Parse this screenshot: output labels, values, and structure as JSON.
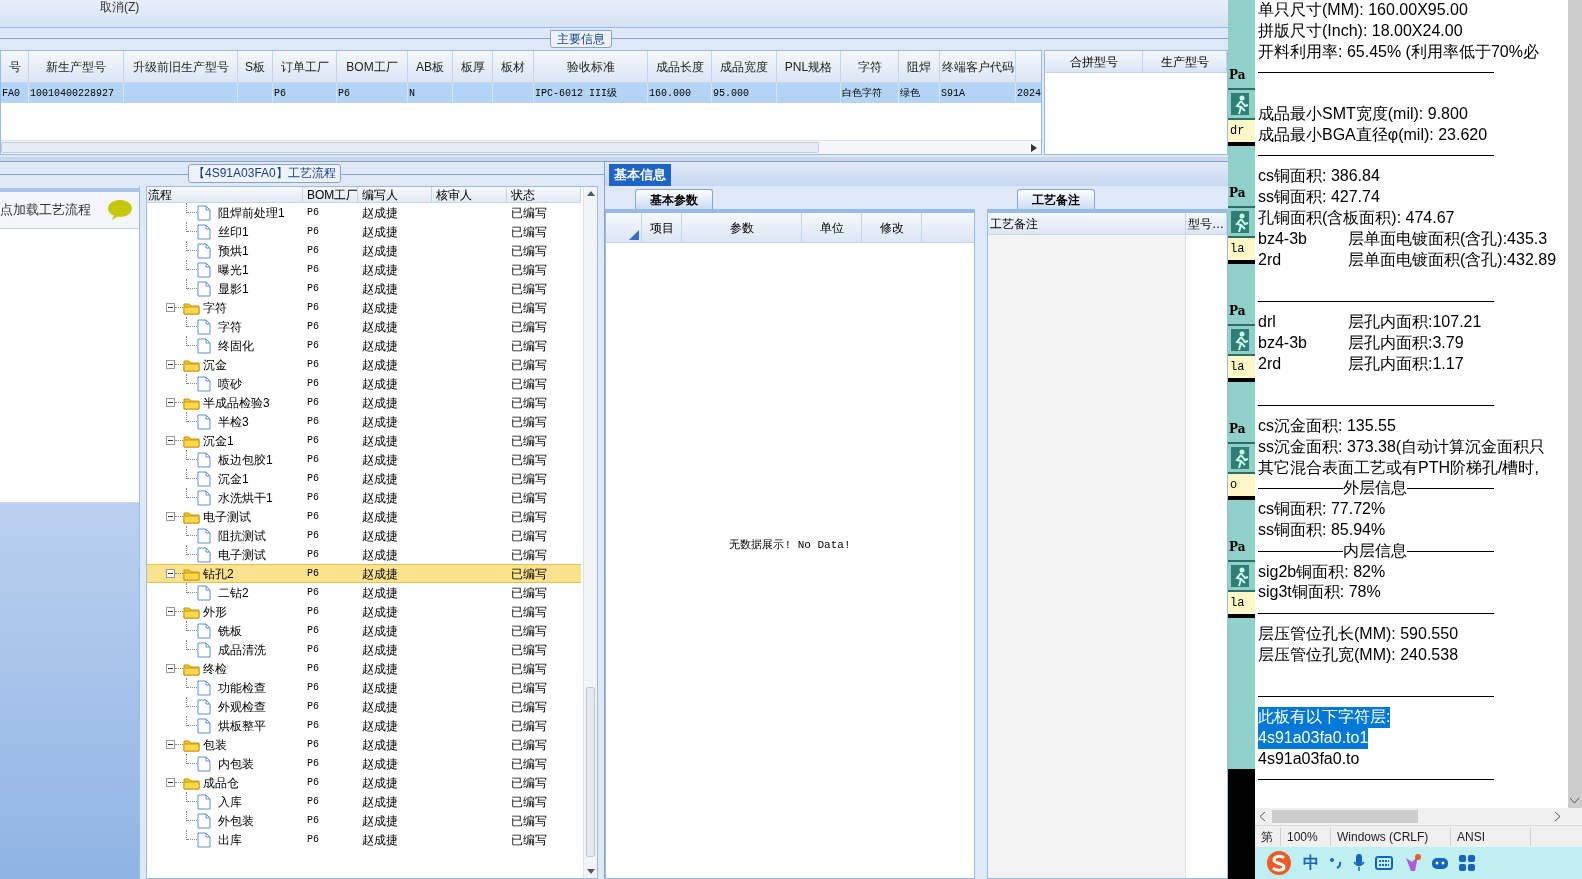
{
  "toolbar": {
    "cancel_label": "取消(Z)"
  },
  "main_section": {
    "title": "主要信息"
  },
  "main_table": {
    "row_selected": true,
    "columns": [
      {
        "header": "号",
        "value": "FA0"
      },
      {
        "header": "新生产型号",
        "value": "10010400228927"
      },
      {
        "header": "升级前旧生产型号"
      },
      {
        "header": "S板"
      },
      {
        "header": "订单工厂",
        "value": "P6"
      },
      {
        "header": "BOM工厂",
        "value": "P6"
      },
      {
        "header": "AB板",
        "value": "N"
      },
      {
        "header": "板厚"
      },
      {
        "header": "板材"
      },
      {
        "header": "验收标准",
        "value": "IPC-6012 III级"
      },
      {
        "header": "成品长度",
        "value": "160.000"
      },
      {
        "header": "成品宽度",
        "value": "95.000"
      },
      {
        "header": "PNL规格"
      },
      {
        "header": "字符",
        "value": "白色字符"
      },
      {
        "header": "阻焊",
        "value": "绿色"
      },
      {
        "header": "终端客户代码",
        "value": "S91A"
      },
      {
        "value": "2024"
      }
    ]
  },
  "merge_table": {
    "columns": [
      "合拼型号",
      "生产型号"
    ]
  },
  "flow_panel": {
    "title": "【4S91A03FA0】工艺流程"
  },
  "sidebar": {
    "hint": "点加载工艺流程"
  },
  "flow_tree": {
    "columns": [
      "流程",
      "BOM工厂",
      "编写人",
      "核审人",
      "状态"
    ],
    "items": [
      {
        "label": "阻焊前处理1",
        "factory": "P6",
        "author": "赵成捷",
        "status": "已编写",
        "selected": false
      },
      {
        "label": "丝印1",
        "factory": "P6",
        "author": "赵成捷",
        "status": "已编写",
        "selected": false
      },
      {
        "label": "预烘1",
        "factory": "P6",
        "author": "赵成捷",
        "status": "已编写",
        "selected": false
      },
      {
        "label": "曝光1",
        "factory": "P6",
        "author": "赵成捷",
        "status": "已编写",
        "selected": false
      },
      {
        "label": "显影1",
        "factory": "P6",
        "author": "赵成捷",
        "status": "已编写",
        "selected": false
      },
      {
        "label": "字符",
        "factory": "P6",
        "author": "赵成捷",
        "status": "已编写",
        "selected": false,
        "expanded": true,
        "children": [
          {
            "label": "字符",
            "factory": "P6",
            "author": "赵成捷",
            "status": "已编写",
            "selected": false
          },
          {
            "label": "终固化",
            "factory": "P6",
            "author": "赵成捷",
            "status": "已编写",
            "selected": false
          }
        ]
      },
      {
        "label": "沉金",
        "factory": "P6",
        "author": "赵成捷",
        "status": "已编写",
        "selected": false,
        "expanded": true,
        "children": [
          {
            "label": "喷砂",
            "factory": "P6",
            "author": "赵成捷",
            "status": "已编写",
            "selected": false
          }
        ]
      },
      {
        "label": "半成品检验3",
        "factory": "P6",
        "author": "赵成捷",
        "status": "已编写",
        "selected": false,
        "expanded": true,
        "children": [
          {
            "label": "半检3",
            "factory": "P6",
            "author": "赵成捷",
            "status": "已编写",
            "selected": false
          }
        ]
      },
      {
        "label": "沉金1",
        "factory": "P6",
        "author": "赵成捷",
        "status": "已编写",
        "selected": false,
        "expanded": true,
        "children": [
          {
            "label": "板边包胶1",
            "factory": "P6",
            "author": "赵成捷",
            "status": "已编写",
            "selected": false
          },
          {
            "label": "沉金1",
            "factory": "P6",
            "author": "赵成捷",
            "status": "已编写",
            "selected": false
          },
          {
            "label": "水洗烘干1",
            "factory": "P6",
            "author": "赵成捷",
            "status": "已编写",
            "selected": false
          }
        ]
      },
      {
        "label": "电子测试",
        "factory": "P6",
        "author": "赵成捷",
        "status": "已编写",
        "selected": false,
        "expanded": true,
        "children": [
          {
            "label": "阻抗测试",
            "factory": "P6",
            "author": "赵成捷",
            "status": "已编写",
            "selected": false
          },
          {
            "label": "电子测试",
            "factory": "P6",
            "author": "赵成捷",
            "status": "已编写",
            "selected": false
          }
        ]
      },
      {
        "label": "钻孔2",
        "factory": "P6",
        "author": "赵成捷",
        "status": "已编写",
        "selected": true,
        "expanded": true,
        "children": [
          {
            "label": "二钻2",
            "factory": "P6",
            "author": "赵成捷",
            "status": "已编写",
            "selected": false
          }
        ]
      },
      {
        "label": "外形",
        "factory": "P6",
        "author": "赵成捷",
        "status": "已编写",
        "selected": false,
        "expanded": true,
        "children": [
          {
            "label": "铣板",
            "factory": "P6",
            "author": "赵成捷",
            "status": "已编写",
            "selected": false
          },
          {
            "label": "成品清洗",
            "factory": "P6",
            "author": "赵成捷",
            "status": "已编写",
            "selected": false
          }
        ]
      },
      {
        "label": "终检",
        "factory": "P6",
        "author": "赵成捷",
        "status": "已编写",
        "selected": false,
        "expanded": true,
        "children": [
          {
            "label": "功能检查",
            "factory": "P6",
            "author": "赵成捷",
            "status": "已编写",
            "selected": false
          },
          {
            "label": "外观检查",
            "factory": "P6",
            "author": "赵成捷",
            "status": "已编写",
            "selected": false
          },
          {
            "label": "烘板整平",
            "factory": "P6",
            "author": "赵成捷",
            "status": "已编写",
            "selected": false
          }
        ]
      },
      {
        "label": "包装",
        "factory": "P6",
        "author": "赵成捷",
        "status": "已编写",
        "selected": false,
        "expanded": true,
        "children": [
          {
            "label": "内包装",
            "factory": "P6",
            "author": "赵成捷",
            "status": "已编写",
            "selected": false
          }
        ]
      },
      {
        "label": "成品仓",
        "factory": "P6",
        "author": "赵成捷",
        "status": "已编写",
        "selected": false,
        "expanded": true,
        "children": [
          {
            "label": "入库",
            "factory": "P6",
            "author": "赵成捷",
            "status": "已编写",
            "selected": false
          },
          {
            "label": "外包装",
            "factory": "P6",
            "author": "赵成捷",
            "status": "已编写",
            "selected": false
          },
          {
            "label": "出库",
            "factory": "P6",
            "author": "赵成捷",
            "status": "已编写",
            "selected": false
          }
        ]
      }
    ]
  },
  "detail_tabs": [
    {
      "label": "基本信息",
      "selected": true
    }
  ],
  "params_panel": {
    "tab": "基本参数",
    "columns": [
      "项目",
      "参数",
      "单位",
      "修改"
    ],
    "empty_text": "无数据展示! No Data!"
  },
  "notes_panel": {
    "tab": "工艺备注",
    "columns": [
      "工艺备注",
      "型号…"
    ]
  },
  "background_window": {
    "blocks": [
      {
        "title": "Pa",
        "tag": "dr"
      },
      {
        "title": "Pa",
        "tag": "la"
      },
      {
        "title": "Pa",
        "tag": "la"
      },
      {
        "title": "Pa",
        "tag": "o"
      },
      {
        "title": "Pa",
        "tag": "la"
      }
    ]
  },
  "notepad": {
    "lines": [
      {
        "kind": "text",
        "text": "单只尺寸(MM): 160.00X95.00",
        "selected": false
      },
      {
        "kind": "text",
        "text": "拼版尺寸(Inch): 18.00X24.00",
        "selected": false
      },
      {
        "kind": "text",
        "text": "开料利用率: 65.45% (利用率低于70%必",
        "selected": false
      },
      {
        "kind": "rule"
      },
      {
        "kind": "blank"
      },
      {
        "kind": "text",
        "text": "成品最小SMT宽度(mil): 9.800",
        "selected": false
      },
      {
        "kind": "text",
        "text": "成品最小BGA直径φ(mil):  23.620",
        "selected": false
      },
      {
        "kind": "rule"
      },
      {
        "kind": "text",
        "text": "cs铜面积: 386.84",
        "selected": false
      },
      {
        "kind": "text",
        "text": "ss铜面积: 427.74",
        "selected": false
      },
      {
        "kind": "text",
        "text": "孔铜面积(含板面积): 474.67",
        "selected": false
      },
      {
        "kind": "pair",
        "key": "bz4-3b",
        "text": "层单面电镀面积(含孔):435.3",
        "selected": false
      },
      {
        "kind": "pair",
        "key": "2rd",
        "text": "层单面电镀面积(含孔):432.89",
        "selected": false
      },
      {
        "kind": "blank"
      },
      {
        "kind": "rule"
      },
      {
        "kind": "pair",
        "key": "drl",
        "text": "层孔内面积:107.21",
        "selected": false
      },
      {
        "kind": "pair",
        "key": "bz4-3b",
        "text": "层孔内面积:3.79",
        "selected": false
      },
      {
        "kind": "pair",
        "key": "2rd",
        "text": "层孔内面积:1.17",
        "selected": false
      },
      {
        "kind": "blank"
      },
      {
        "kind": "rule"
      },
      {
        "kind": "text",
        "text": "cs沉金面积: 135.55",
        "selected": false
      },
      {
        "kind": "text",
        "text": "ss沉金面积: 373.38(自动计算沉金面积只",
        "selected": false
      },
      {
        "kind": "text",
        "text": "其它混合表面工艺或有PTH阶梯孔/槽时,",
        "selected": false
      },
      {
        "kind": "heading",
        "text": "外层信息"
      },
      {
        "kind": "text",
        "text": "cs铜面积: 77.72%",
        "selected": false
      },
      {
        "kind": "text",
        "text": "ss铜面积: 85.94%",
        "selected": false
      },
      {
        "kind": "heading",
        "text": "内层信息"
      },
      {
        "kind": "text",
        "text": "sig2b铜面积: 82%",
        "selected": false
      },
      {
        "kind": "text",
        "text": "sig3t铜面积: 78%",
        "selected": false
      },
      {
        "kind": "rule"
      },
      {
        "kind": "text",
        "text": "层压管位孔长(MM): 590.550",
        "selected": false
      },
      {
        "kind": "text",
        "text": "层压管位孔宽(MM): 240.538",
        "selected": false
      },
      {
        "kind": "blank"
      },
      {
        "kind": "rule"
      },
      {
        "kind": "text",
        "text": "此板有以下字符层:",
        "selected": true
      },
      {
        "kind": "text",
        "text": "4s91a03fa0.to1",
        "selected": true
      },
      {
        "kind": "text",
        "text": "4s91a03fa0.to",
        "selected": false
      },
      {
        "kind": "rule"
      }
    ],
    "status_bar": [
      "第",
      "100%",
      "Windows (CRLF)",
      "ANSI"
    ]
  },
  "ime_toolbar": {
    "label": "中"
  }
}
